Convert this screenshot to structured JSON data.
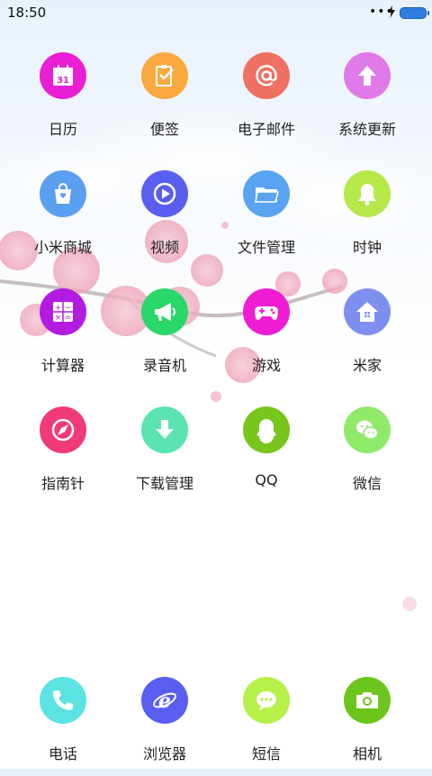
{
  "status": {
    "time": "18:50"
  },
  "apps": [
    {
      "label": "日历",
      "icon": "calendar-icon",
      "color": "#e91fd6",
      "day": "31"
    },
    {
      "label": "便签",
      "icon": "notepad-icon",
      "color": "#f9a93e"
    },
    {
      "label": "电子邮件",
      "icon": "at-sign-icon",
      "color": "#f07062"
    },
    {
      "label": "系统更新",
      "icon": "arrow-up-icon",
      "color": "#e07ae8"
    },
    {
      "label": "小米商城",
      "icon": "shopping-bag-icon",
      "color": "#5b9ff0"
    },
    {
      "label": "视频",
      "icon": "play-icon",
      "color": "#5a5ef0"
    },
    {
      "label": "文件管理",
      "icon": "folder-icon",
      "color": "#5aa3f0"
    },
    {
      "label": "时钟",
      "icon": "bell-icon",
      "color": "#b6e84a"
    },
    {
      "label": "计算器",
      "icon": "calculator-icon",
      "color": "#b21be0"
    },
    {
      "label": "录音机",
      "icon": "megaphone-icon",
      "color": "#2ad86a"
    },
    {
      "label": "游戏",
      "icon": "gamepad-icon",
      "color": "#f01cd3"
    },
    {
      "label": "米家",
      "icon": "home-icon",
      "color": "#7f8ff0"
    },
    {
      "label": "指南针",
      "icon": "compass-icon",
      "color": "#f03a7a"
    },
    {
      "label": "下载管理",
      "icon": "download-icon",
      "color": "#5ae3b0"
    },
    {
      "label": "QQ",
      "icon": "qq-penguin-icon",
      "color": "#78c51c"
    },
    {
      "label": "微信",
      "icon": "wechat-icon",
      "color": "#8fea6a"
    }
  ],
  "dock": [
    {
      "label": "电话",
      "icon": "phone-icon",
      "color": "#5ae3e0"
    },
    {
      "label": "浏览器",
      "icon": "browser-icon",
      "color": "#5a5ef0"
    },
    {
      "label": "短信",
      "icon": "message-icon",
      "color": "#b6f04a"
    },
    {
      "label": "相机",
      "icon": "camera-icon",
      "color": "#6cc51c"
    }
  ]
}
